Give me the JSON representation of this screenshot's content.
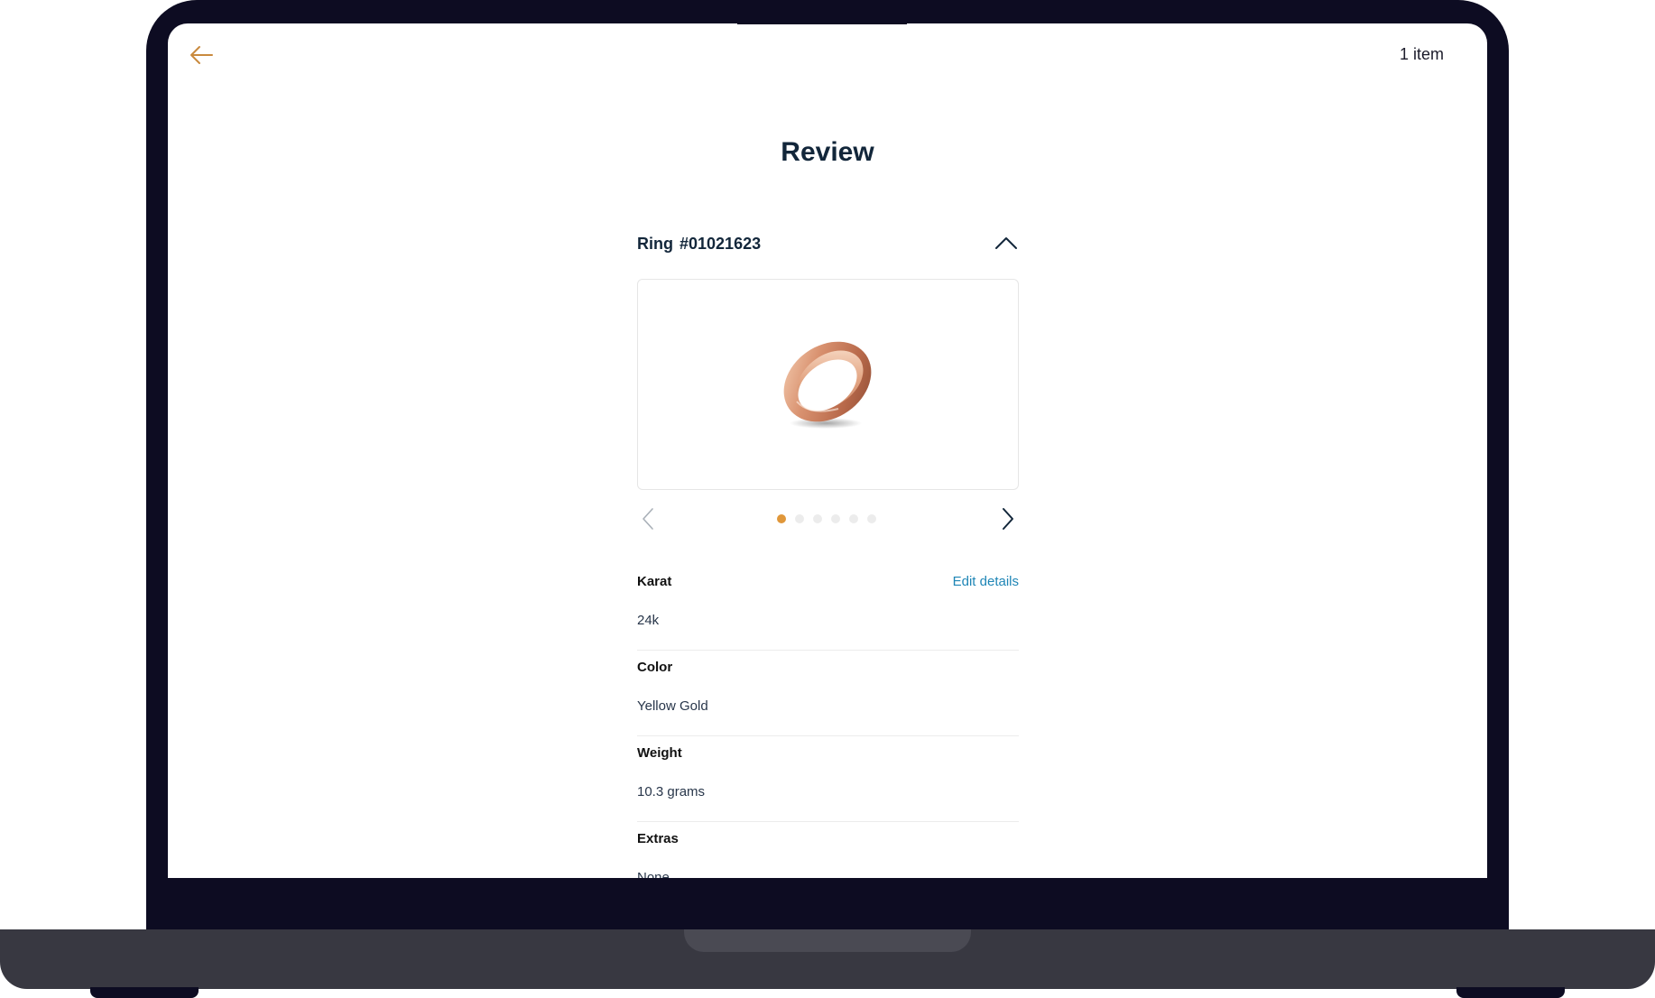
{
  "header": {
    "item_count": "1 item"
  },
  "page": {
    "title": "Review"
  },
  "product": {
    "type": "Ring",
    "number": "#01021623",
    "image_icon": "ring-image",
    "carousel": {
      "total_images": 6,
      "current_index": 1
    }
  },
  "details": {
    "edit_label": "Edit details",
    "fields": [
      {
        "label": "Karat",
        "value": "24k"
      },
      {
        "label": "Color",
        "value": "Yellow Gold"
      },
      {
        "label": "Weight",
        "value": "10.3 grams"
      },
      {
        "label": "Extras",
        "value": "None"
      }
    ]
  },
  "colors": {
    "accent": "#e0973a",
    "title": "#12263a",
    "link": "#1f86b6",
    "frame": "#0d0c22"
  }
}
